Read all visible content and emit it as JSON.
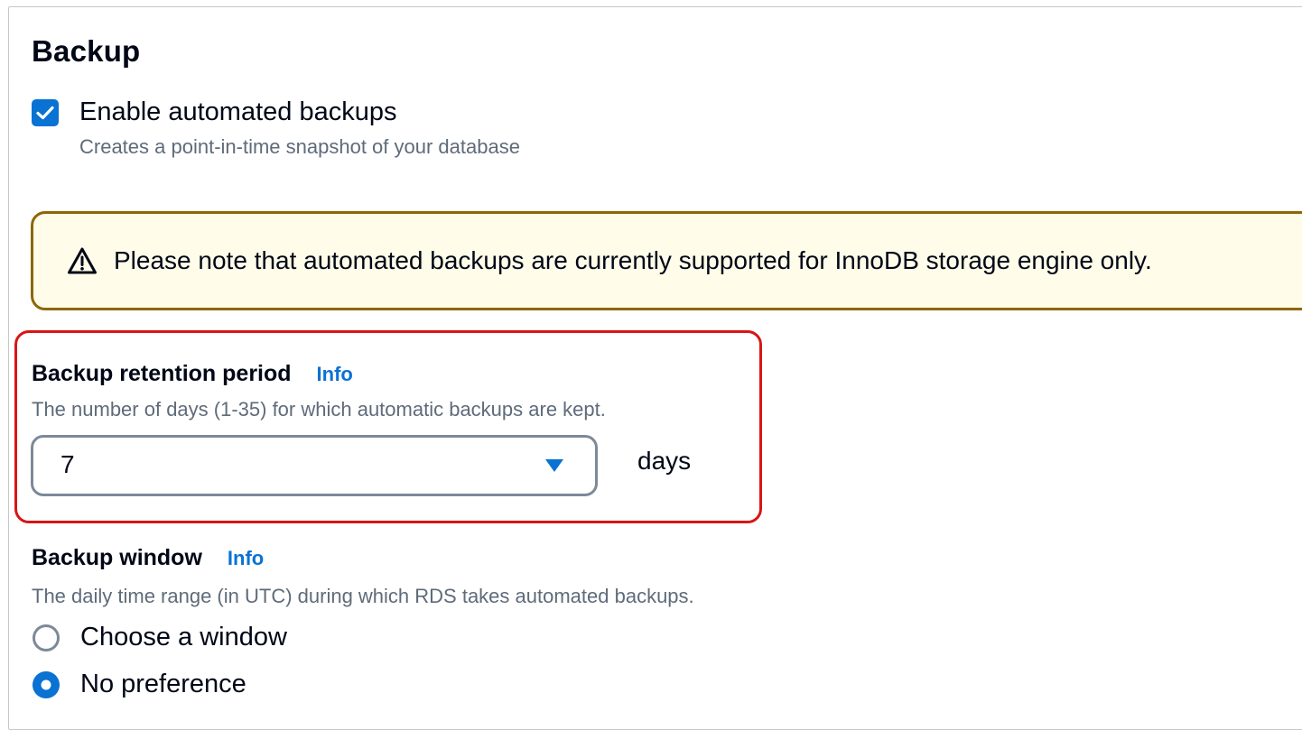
{
  "backup": {
    "title": "Backup",
    "automated_backups": {
      "label": "Enable automated backups",
      "description": "Creates a point-in-time snapshot of your database",
      "checked": true
    },
    "alert": {
      "icon": "warning-icon",
      "text": "Please note that automated backups are currently supported for InnoDB storage engine only.",
      "colors": {
        "border": "#8d6605",
        "background": "#fffce9"
      }
    },
    "retention": {
      "label": "Backup retention period",
      "info": "Info",
      "description": "The number of days (1-35) for which automatic backups are kept.",
      "value": "7",
      "unit": "days",
      "highlight_color": "#d91515"
    },
    "window": {
      "label": "Backup window",
      "info": "Info",
      "description": "The daily time range (in UTC) during which RDS takes automated backups.",
      "options": [
        {
          "label": "Choose a window",
          "selected": false
        },
        {
          "label": "No preference",
          "selected": true
        }
      ]
    }
  },
  "colors": {
    "accent": "#0972d3",
    "text": "#000716",
    "secondary_text": "#5f6b7a"
  }
}
